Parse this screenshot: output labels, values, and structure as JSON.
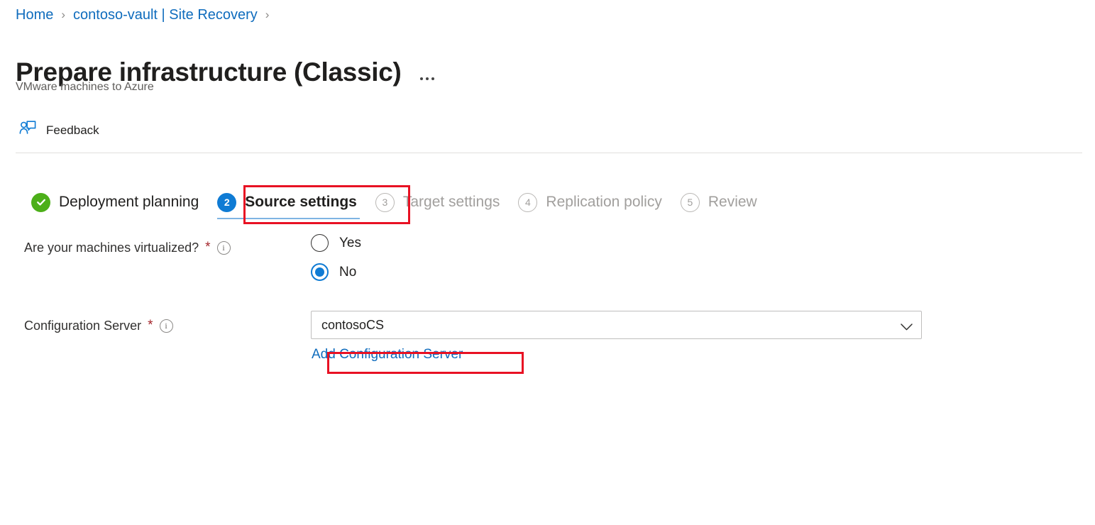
{
  "breadcrumb": {
    "separator": "›",
    "items": [
      {
        "label": "Home"
      },
      {
        "label": "contoso-vault | Site Recovery"
      }
    ]
  },
  "header": {
    "title": "Prepare infrastructure (Classic)",
    "subtitle": "VMware machines to Azure",
    "more_menu": "…"
  },
  "commandbar": {
    "feedback_label": "Feedback"
  },
  "wizard": {
    "steps": [
      {
        "number": "1",
        "label": "Deployment planning",
        "state": "done"
      },
      {
        "number": "2",
        "label": "Source settings",
        "state": "active"
      },
      {
        "number": "3",
        "label": "Target settings",
        "state": "pending"
      },
      {
        "number": "4",
        "label": "Replication policy",
        "state": "pending"
      },
      {
        "number": "5",
        "label": "Review",
        "state": "pending"
      }
    ]
  },
  "form": {
    "virtualized": {
      "label": "Are your machines virtualized?",
      "required_marker": "*",
      "info_glyph": "i",
      "options": [
        {
          "label": "Yes",
          "selected": false
        },
        {
          "label": "No",
          "selected": true
        }
      ]
    },
    "configuration_server": {
      "label": "Configuration Server",
      "required_marker": "*",
      "info_glyph": "i",
      "value": "contosoCS",
      "add_link": "Add Configuration Server"
    }
  },
  "colors": {
    "accent_blue": "#0f7bd4",
    "link_blue": "#0f6cbd",
    "success_green": "#4caf19",
    "required_red": "#a4262c",
    "annotation_red": "#e81123",
    "disabled_grey": "#a19f9d"
  }
}
